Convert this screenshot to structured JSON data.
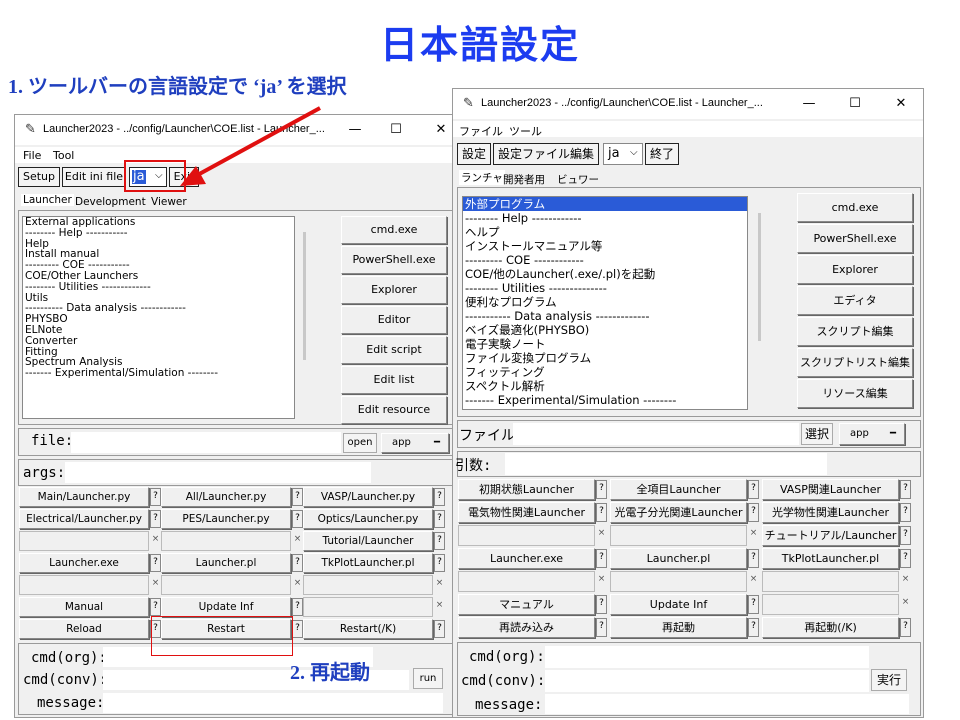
{
  "page": {
    "title": "日本語設定",
    "step1": "1. ツールバーの言語設定で ‘ja’ を選択",
    "step2": "2. 再起動"
  },
  "colors": {
    "title": "#1c3cf0",
    "caption": "#1f3fbf",
    "highlight": "#e01010",
    "selection": "#2a5bd7"
  },
  "en": {
    "window_title": "Launcher2023 - ../config/Launcher\\COE.list - Launcher_...",
    "menu": [
      "File",
      "Tool"
    ],
    "toolbar": {
      "setup": "Setup",
      "edit_ini": "Edit ini file",
      "lang": "ja",
      "exit": "Exit"
    },
    "tabs": [
      "Launcher",
      "Development",
      "Viewer"
    ],
    "list": [
      "External applications",
      "-------- Help -----------",
      "Help",
      "Install manual",
      "--------- COE -----------",
      "COE/Other Launchers",
      "-------- Utilities -------------",
      "Utils",
      "---------- Data analysis ------------",
      "PHYSBO",
      "ELNote",
      "Converter",
      "Fitting",
      "Spectrum Analysis",
      "------- Experimental/Simulation --------"
    ],
    "side_buttons": [
      "cmd.exe",
      "PowerShell.exe",
      "Explorer",
      "Editor",
      "Edit script",
      "Edit list",
      "Edit resource"
    ],
    "file_label": "file:",
    "open": "open",
    "app": "app",
    "args_label": "args:",
    "grid": [
      [
        "Main/Launcher.py",
        "All/Launcher.py",
        "VASP/Launcher.py"
      ],
      [
        "Electrical/Launcher.py",
        "PES/Launcher.py",
        "Optics/Launcher.py"
      ],
      [
        "",
        "",
        "Tutorial/Launcher"
      ],
      [
        "Launcher.exe",
        "Launcher.pl",
        "TkPlotLauncher.pl"
      ],
      [
        "",
        "",
        ""
      ],
      [
        "Manual",
        "Update Inf",
        ""
      ],
      [
        "Reload",
        "Restart",
        "Restart(/K)"
      ]
    ],
    "cmd_org": "cmd(org):",
    "cmd_conv": "cmd(conv):",
    "message": "message:",
    "run": "run"
  },
  "ja": {
    "window_title": "Launcher2023 - ../config/Launcher\\COE.list - Launcher_...",
    "menu": [
      "ファイル",
      "ツール"
    ],
    "toolbar": {
      "setup": "設定",
      "edit_ini": "設定ファイル編集",
      "lang": "ja",
      "exit": "終了"
    },
    "tabs": [
      "ランチャ",
      "開発者用",
      "ビュワー"
    ],
    "list": [
      "外部プログラム",
      "-------- Help ------------",
      "ヘルプ",
      "インストールマニュアル等",
      "--------- COE ------------",
      "COE/他のLauncher(.exe/.pl)を起動",
      "-------- Utilities --------------",
      "便利なプログラム",
      "----------- Data analysis -------------",
      "ベイズ最適化(PHYSBO)",
      "電子実験ノート",
      "ファイル変換プログラム",
      "フィッティング",
      "スペクトル解析",
      "------- Experimental/Simulation --------"
    ],
    "side_buttons": [
      "cmd.exe",
      "PowerShell.exe",
      "Explorer",
      "エディタ",
      "スクリプト編集",
      "スクリプトリスト編集",
      "リソース編集"
    ],
    "file_label": "ファイル:",
    "select": "選択",
    "app": "app",
    "args_label": "引数:",
    "grid": [
      [
        "初期状態Launcher",
        "全項目Launcher",
        "VASP関連Launcher"
      ],
      [
        "電気物性関連Launcher",
        "光電子分光関連Launcher",
        "光学物性関連Launcher"
      ],
      [
        "",
        "",
        "チュートリアル/Launcher"
      ],
      [
        "Launcher.exe",
        "Launcher.pl",
        "TkPlotLauncher.pl"
      ],
      [
        "",
        "",
        ""
      ],
      [
        "マニュアル",
        "Update Inf",
        ""
      ],
      [
        "再読み込み",
        "再起動",
        "再起動(/K)"
      ]
    ],
    "cmd_org": "cmd(org):",
    "cmd_conv": "cmd(conv):",
    "message": "message:",
    "run": "実行"
  },
  "window_controls": {
    "minimize": "—",
    "maximize": "☐",
    "close": "✕"
  },
  "glyphs": {
    "pen": "✎",
    "dropdown": "⌵",
    "question": "?",
    "disabled": "×"
  }
}
